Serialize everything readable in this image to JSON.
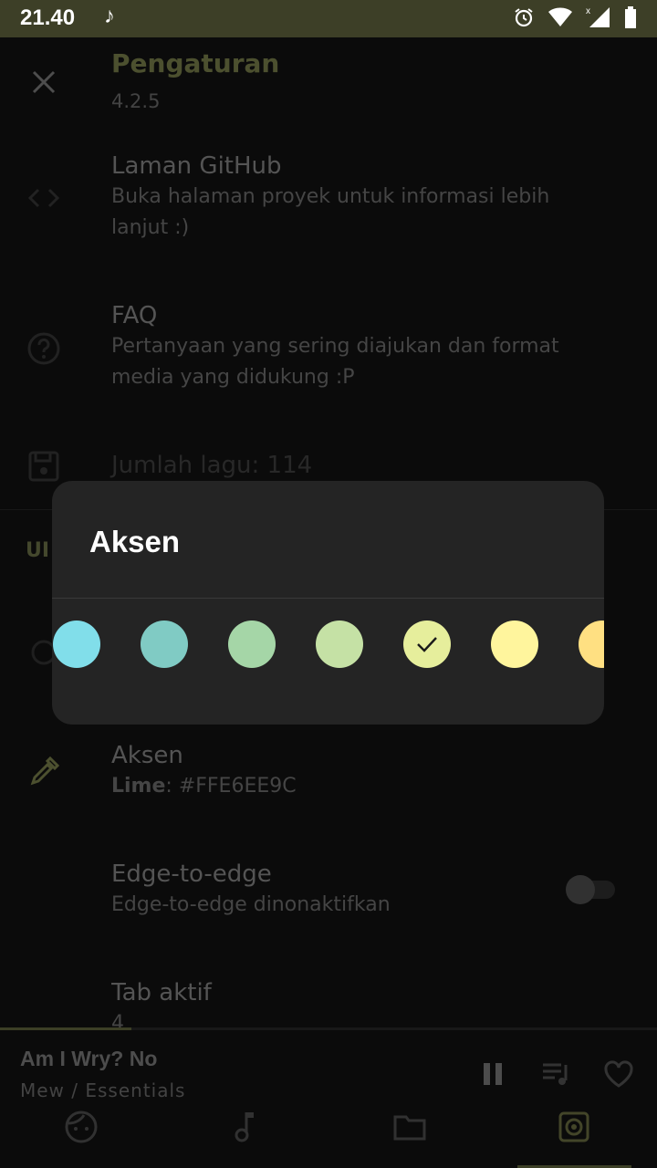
{
  "status_bar": {
    "time": "21.40"
  },
  "header": {
    "title": "Pengaturan",
    "version": "4.2.5"
  },
  "prefs": {
    "github": {
      "title": "Laman GitHub",
      "summary_line1": "Buka halaman proyek untuk informasi lebih",
      "summary_line2": "lanjut :)"
    },
    "faq": {
      "title": "FAQ",
      "summary_line1": "Pertanyaan yang sering diajukan dan format",
      "summary_line2": "media yang didukung :P"
    },
    "song_count": {
      "title": "Jumlah lagu: 114"
    },
    "section_ui": "UI",
    "accent": {
      "title": "Aksen",
      "name": "Lime",
      "sep": ": ",
      "hex": "#FFE6EE9C"
    },
    "edge": {
      "title": "Edge-to-edge",
      "summary": "Edge-to-edge dinonaktifkan"
    },
    "tabs": {
      "title": "Tab aktif",
      "value": "4"
    }
  },
  "dialog": {
    "title": "Aksen",
    "swatches": [
      {
        "name": "Light Blue",
        "color": "#81DEEA",
        "selected": false
      },
      {
        "name": "Teal",
        "color": "#80CBC4",
        "selected": false
      },
      {
        "name": "Green",
        "color": "#A5D6A7",
        "selected": false
      },
      {
        "name": "Light Green",
        "color": "#C5E1A5",
        "selected": false
      },
      {
        "name": "Lime",
        "color": "#E6EE9C",
        "selected": true
      },
      {
        "name": "Yellow",
        "color": "#FFF59D",
        "selected": false
      },
      {
        "name": "Amber",
        "color": "#FFE082",
        "selected": false
      }
    ]
  },
  "player": {
    "song": "Am I Wry? No",
    "artist_album": "Mew / Essentials",
    "progress": 0.2
  },
  "colors": {
    "accent": "#E6EE9C",
    "status_bar": "#3D3F27"
  },
  "nav": [
    "artist-face-icon",
    "music-note-icon",
    "folder-icon",
    "settings-icon"
  ]
}
